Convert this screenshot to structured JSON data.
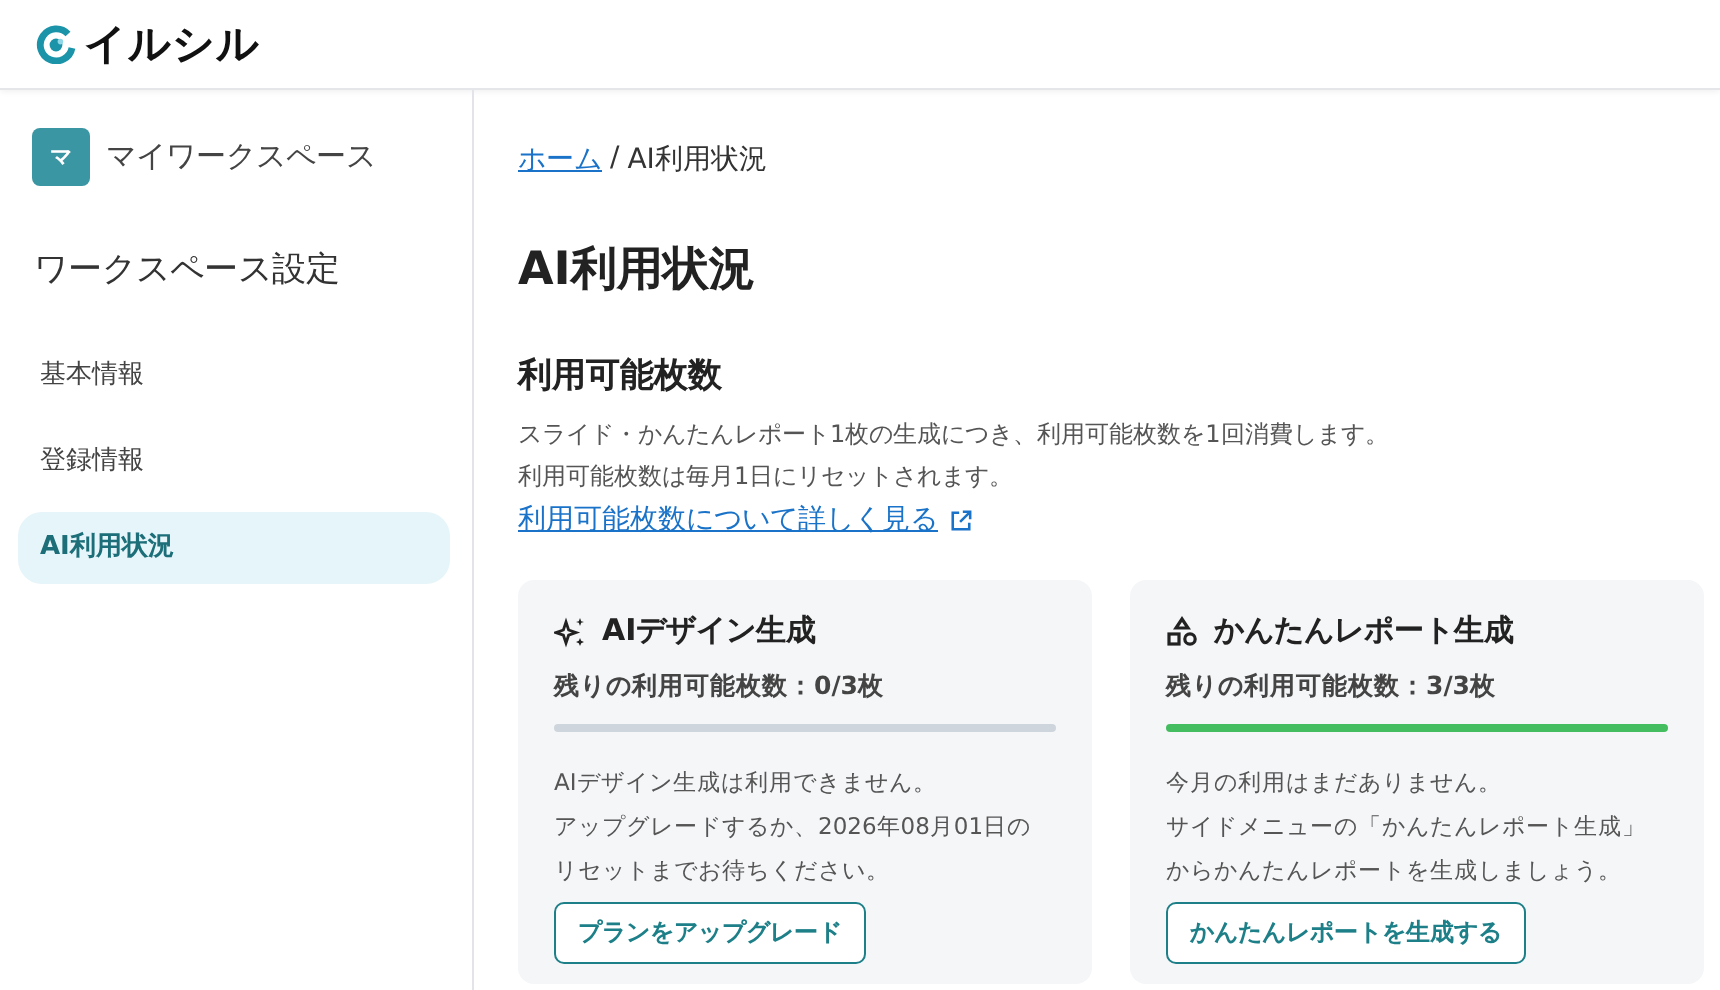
{
  "header": {
    "logo_text": "イルシル"
  },
  "sidebar": {
    "workspace": {
      "avatar": "マ",
      "name": "マイワークスペース"
    },
    "section_title": "ワークスペース設定",
    "items": [
      {
        "label": "基本情報",
        "selected": false
      },
      {
        "label": "登録情報",
        "selected": false
      },
      {
        "label": "AI利用状況",
        "selected": true
      }
    ]
  },
  "breadcrumb": {
    "home": "ホーム",
    "separator": "/",
    "current": "AI利用状況"
  },
  "page_title": "AI利用状況",
  "section": {
    "title": "利用可能枚数",
    "description": [
      "スライド・かんたんレポート1枚の生成につき、利用可能枚数を1回消費します。",
      "利用可能枚数は毎月1日にリセットされます。"
    ],
    "link": "利用可能枚数について詳しく見る"
  },
  "cards": [
    {
      "kind": "sparkle",
      "title": "AIデザイン生成",
      "remaining": "残りの利用可能枚数：0/3枚",
      "level": 0,
      "message": [
        "AIデザイン生成は利用できません。",
        "アップグレードするか、2026年08月01日の",
        "リセットまでお待ちください。"
      ],
      "button": "プランをアップグレード"
    },
    {
      "kind": "shapes",
      "title": "かんたんレポート生成",
      "remaining": "残りの利用可能枚数：3/3枚",
      "level": 1,
      "message": [
        "今月の利用はまだありません。",
        "サイドメニューの「かんたんレポート生成」",
        "からかんたんレポートを生成しましょう。"
      ],
      "button": "かんたんレポートを生成する"
    }
  ]
}
